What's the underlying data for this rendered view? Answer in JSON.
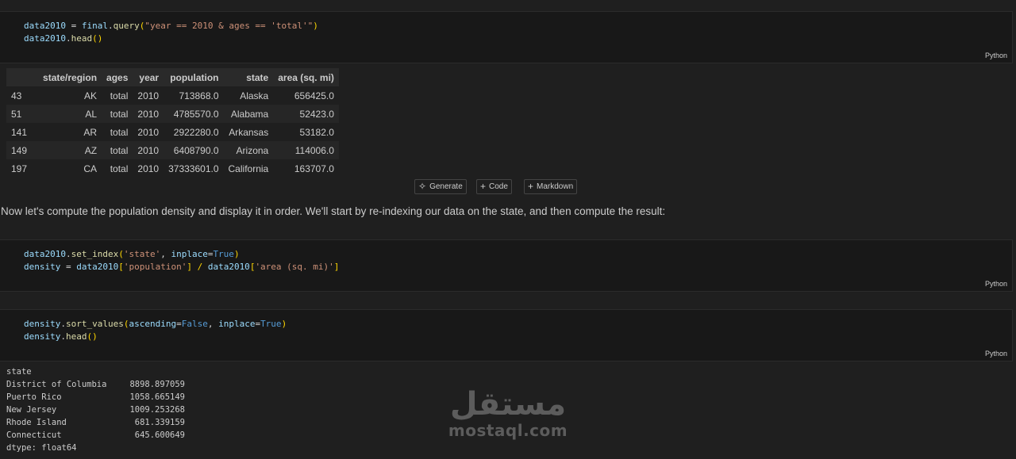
{
  "cells": [
    {
      "lang": "Python"
    },
    {
      "lang": "Python"
    },
    {
      "lang": "Python"
    }
  ],
  "code1": {
    "l1": [
      "data2010",
      " = ",
      "final",
      ".",
      "query",
      "(",
      "\"year == 2010 & ages == 'total'\"",
      ")"
    ],
    "l2": [
      "data2010",
      ".",
      "head",
      "()"
    ]
  },
  "code2": {
    "l1": [
      "data2010",
      ".",
      "set_index",
      "(",
      "'state'",
      ", ",
      "inplace",
      "=",
      "True",
      ")"
    ],
    "l2": [
      "density",
      " = ",
      "data2010",
      "[",
      "'population'",
      "] / ",
      "data2010",
      "[",
      "'area (sq. mi)'",
      "]"
    ]
  },
  "code3": {
    "l1": [
      "density",
      ".",
      "sort_values",
      "(",
      "ascending",
      "=",
      "False",
      ", ",
      "inplace",
      "=",
      "True",
      ")"
    ],
    "l2": [
      "density",
      ".",
      "head",
      "()"
    ]
  },
  "table": {
    "columns": [
      "",
      "state/region",
      "ages",
      "year",
      "population",
      "state",
      "area (sq. mi)"
    ],
    "rows": [
      [
        "43",
        "AK",
        "total",
        "2010",
        "713868.0",
        "Alaska",
        "656425.0"
      ],
      [
        "51",
        "AL",
        "total",
        "2010",
        "4785570.0",
        "Alabama",
        "52423.0"
      ],
      [
        "141",
        "AR",
        "total",
        "2010",
        "2922280.0",
        "Arkansas",
        "53182.0"
      ],
      [
        "149",
        "AZ",
        "total",
        "2010",
        "6408790.0",
        "Arizona",
        "114006.0"
      ],
      [
        "197",
        "CA",
        "total",
        "2010",
        "37333601.0",
        "California",
        "163707.0"
      ]
    ]
  },
  "toolbar": {
    "generate": {
      "label": "Generate",
      "icon": "sparkle-icon"
    },
    "code": {
      "label": "Code",
      "icon": "plus-icon"
    },
    "markdown": {
      "label": "Markdown",
      "icon": "plus-icon"
    }
  },
  "markdown_text": "Now let's compute the population density and display it in order. We'll start by re-indexing our data on the state, and then compute the result:",
  "output": {
    "header": "state",
    "rows": [
      {
        "label": "District of Columbia",
        "value": "8898.897059"
      },
      {
        "label": "Puerto Rico",
        "value": "1058.665149"
      },
      {
        "label": "New Jersey",
        "value": "1009.253268"
      },
      {
        "label": "Rhode Island",
        "value": "681.339159"
      },
      {
        "label": "Connecticut",
        "value": "645.600649"
      }
    ],
    "dtype": "dtype: float64"
  },
  "watermark": {
    "arabic": "مستقل",
    "latin": "mostaql.com"
  }
}
